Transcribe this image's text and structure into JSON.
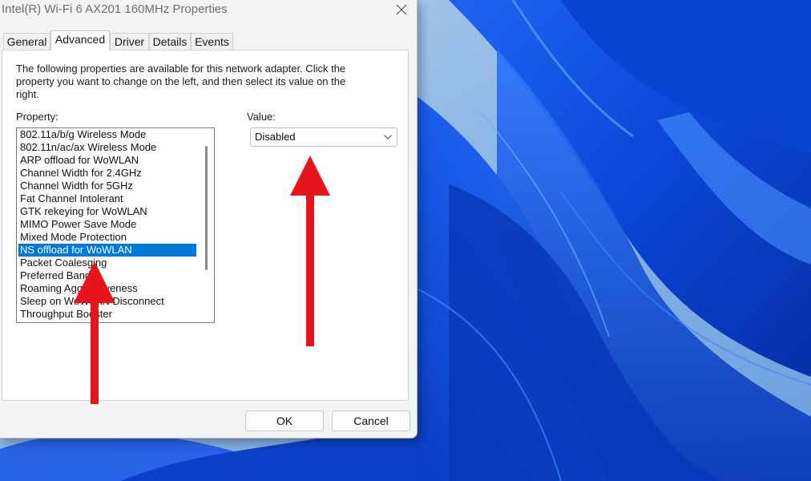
{
  "window": {
    "title": "Intel(R) Wi-Fi 6 AX201 160MHz Properties"
  },
  "tabs": [
    {
      "label": "General"
    },
    {
      "label": "Advanced"
    },
    {
      "label": "Driver"
    },
    {
      "label": "Details"
    },
    {
      "label": "Events"
    }
  ],
  "active_tab": "Advanced",
  "advanced": {
    "description": "The following properties are available for this network adapter. Click the property you want to change on the left, and then select its value on the right.",
    "property_label": "Property:",
    "value_label": "Value:",
    "properties": [
      "802.11a/b/g Wireless Mode",
      "802.11n/ac/ax Wireless Mode",
      "ARP offload for WoWLAN",
      "Channel Width for 2.4GHz",
      "Channel Width for 5GHz",
      "Fat Channel Intolerant",
      "GTK rekeying for WoWLAN",
      "MIMO Power Save Mode",
      "Mixed Mode Protection",
      "NS offload for WoWLAN",
      "Packet Coalesging",
      "Preferred Band",
      "Roaming Aggressiveness",
      "Sleep on WoWLAN Disconnect",
      "Throughput Booster"
    ],
    "selected_property": "NS offload for WoWLAN",
    "value": "Disabled"
  },
  "buttons": {
    "ok": "OK",
    "cancel": "Cancel"
  },
  "colors": {
    "selection": "#0078d7",
    "annotation_arrow": "#e8141c",
    "wallpaper_base": "#0a3fbf"
  },
  "icons": {
    "close": "close-icon",
    "dropdown": "chevron-down-icon"
  }
}
